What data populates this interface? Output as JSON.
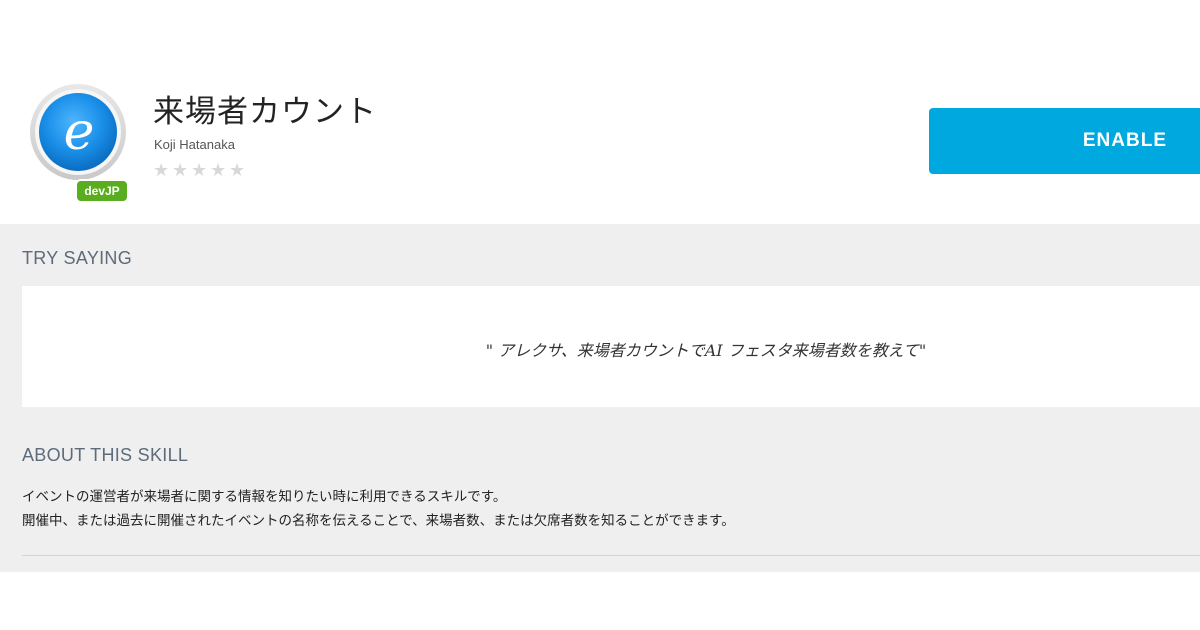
{
  "skill": {
    "title": "来場者カウント",
    "author": "Koji Hatanaka",
    "icon": "e-letter-icon",
    "badge": "devJP",
    "rating_stars": 5,
    "rating_value": 0
  },
  "actions": {
    "enable_label": "ENABLE"
  },
  "try_saying": {
    "heading": "TRY SAYING",
    "phrase": "\" アレクサ、来場者カウントでAI フェスタ来場者数を教えて\""
  },
  "about": {
    "heading": "ABOUT THIS SKILL",
    "lines": [
      "イベントの運営者が来場者に関する情報を知りたい時に利用できるスキルです。",
      "開催中、または過去に開催されたイベントの名称を伝えることで、来場者数、または欠席者数を知ることができます。"
    ]
  },
  "colors": {
    "enable_button": "#00a8e0",
    "badge": "#5aad1f",
    "icon_blue": "#1a8fe8",
    "section_bg": "#efefef",
    "heading_text": "#5d6b7a"
  }
}
